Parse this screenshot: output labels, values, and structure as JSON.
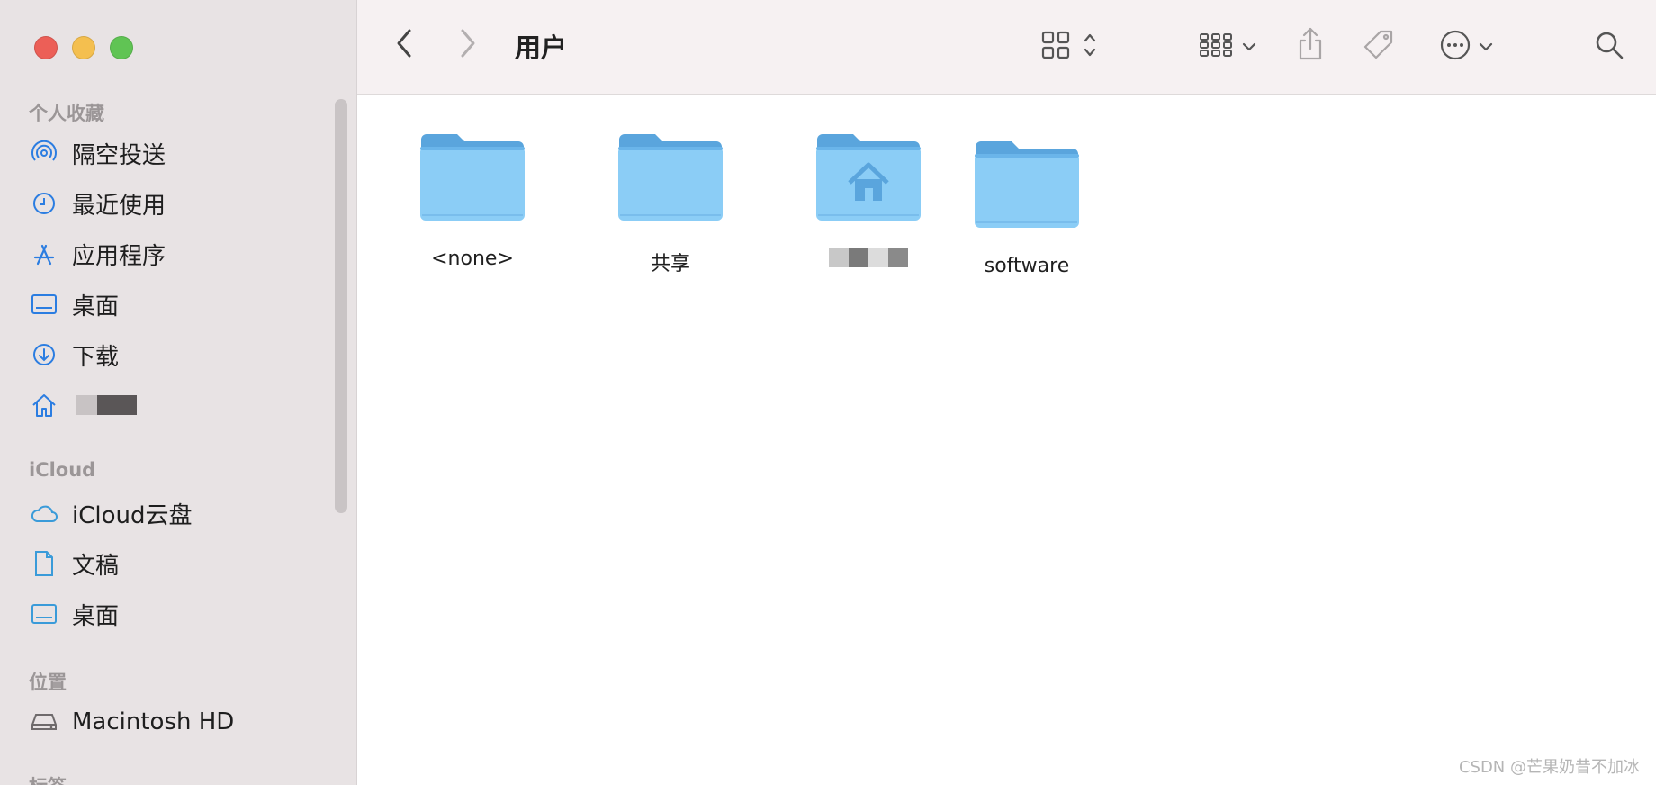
{
  "toolbar": {
    "title": "用户",
    "back_icon": "chevron-left-icon",
    "forward_icon": "chevron-right-icon",
    "view_icon": "grid-view-icon",
    "group_icon": "group-by-icon",
    "share_icon": "share-icon",
    "tag_icon": "tag-icon",
    "more_icon": "ellipsis-circle-icon",
    "search_icon": "search-icon"
  },
  "sidebar": {
    "favorites_title": "个人收藏",
    "favorites": [
      {
        "label": "隔空投送",
        "icon": "airdrop-icon"
      },
      {
        "label": "最近使用",
        "icon": "clock-icon"
      },
      {
        "label": "应用程序",
        "icon": "apps-icon"
      },
      {
        "label": "桌面",
        "icon": "desktop-icon"
      },
      {
        "label": "下载",
        "icon": "download-icon"
      },
      {
        "label": "",
        "icon": "home-icon"
      }
    ],
    "icloud_title": "iCloud",
    "icloud": [
      {
        "label": "iCloud云盘",
        "icon": "cloud-icon"
      },
      {
        "label": "文稿",
        "icon": "document-icon"
      },
      {
        "label": "桌面",
        "icon": "desktop-icon"
      }
    ],
    "locations_title": "位置",
    "locations": [
      {
        "label": "Macintosh HD",
        "icon": "disk-icon"
      }
    ],
    "tags_title": "标签"
  },
  "files": [
    {
      "name": "<none>",
      "icon": "folder-icon"
    },
    {
      "name": "共享",
      "icon": "folder-icon"
    },
    {
      "name": "",
      "icon": "home-folder-icon"
    },
    {
      "name": "software",
      "icon": "folder-icon"
    }
  ],
  "watermark": "CSDN @芒果奶昔不加冰",
  "colors": {
    "accent": "#2b7de1",
    "sidebar_bg": "#e8e3e4",
    "folder_light": "#8bcdf6",
    "folder_dark": "#5aa5dd"
  }
}
